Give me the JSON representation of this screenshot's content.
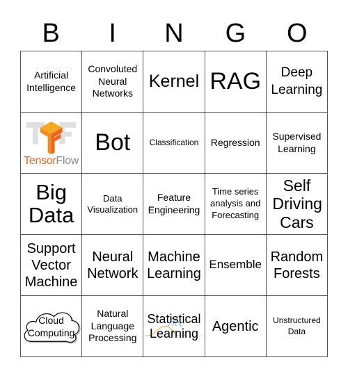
{
  "title_letters": [
    "B",
    "I",
    "N",
    "G",
    "O"
  ],
  "colors": {
    "grid_line": "#555555",
    "tensorflow_orange": "#e8661f",
    "tensorflow_grey": "#8a8a8a"
  },
  "cells": [
    {
      "text": "Artificial Intelligence"
    },
    {
      "text": "Convoluted Neural Networks"
    },
    {
      "text": "Kernel"
    },
    {
      "text": "RAG"
    },
    {
      "text": "Deep Learning"
    },
    {
      "text": "TensorFlow",
      "image": "tensorflow-logo",
      "word_part1": "Tensor",
      "word_part2": "Flow"
    },
    {
      "text": "Bot"
    },
    {
      "text": "Classification"
    },
    {
      "text": "Regression"
    },
    {
      "text": "Supervised Learning"
    },
    {
      "text": "Big Data"
    },
    {
      "text": "Data Visualization"
    },
    {
      "text": "Feature Engineering"
    },
    {
      "text": "Time series analysis and Forecasting"
    },
    {
      "text": "Self Driving Cars"
    },
    {
      "text": "Support Vector Machine"
    },
    {
      "text": "Neural Network"
    },
    {
      "text": "Machine Learning"
    },
    {
      "text": "Ensemble"
    },
    {
      "text": "Random Forests"
    },
    {
      "text": "Cloud Computing",
      "image": "cloud-outline"
    },
    {
      "text": "Natural Language Processing"
    },
    {
      "text": "Statistical Learning",
      "image": "distribution-curve"
    },
    {
      "text": "Agentic"
    },
    {
      "text": "Unstructured Data"
    }
  ]
}
